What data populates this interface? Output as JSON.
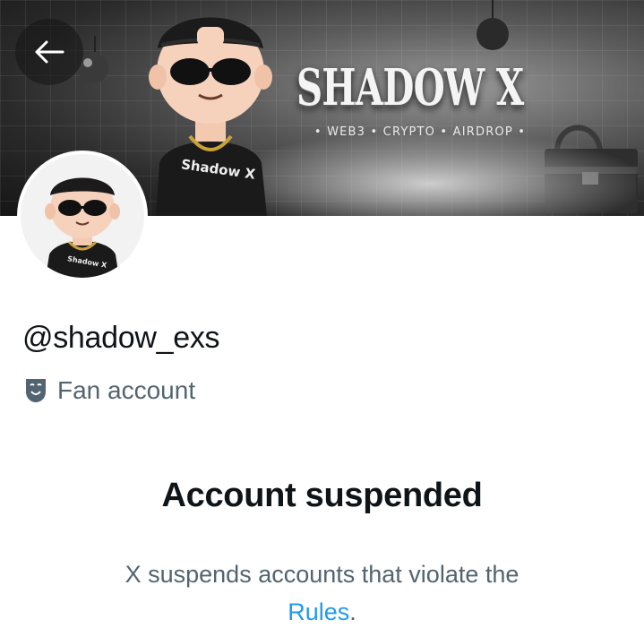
{
  "banner": {
    "title": "SHADOW X",
    "tagline": "• WEB3 • CRYPTO • AIRDROP •",
    "shirt_text": "Shadow X"
  },
  "avatar": {
    "shirt_text": "Shadow X"
  },
  "profile": {
    "handle": "@shadow_exs",
    "label_icon": "theater-masks-icon",
    "label": "Fan account"
  },
  "suspension": {
    "title": "Account suspended",
    "line1": "X suspends accounts that violate the",
    "link": "Rules",
    "trailing": "."
  },
  "colors": {
    "primary_text": "#0f1419",
    "secondary_text": "#536471",
    "link": "#1d9bf0"
  }
}
